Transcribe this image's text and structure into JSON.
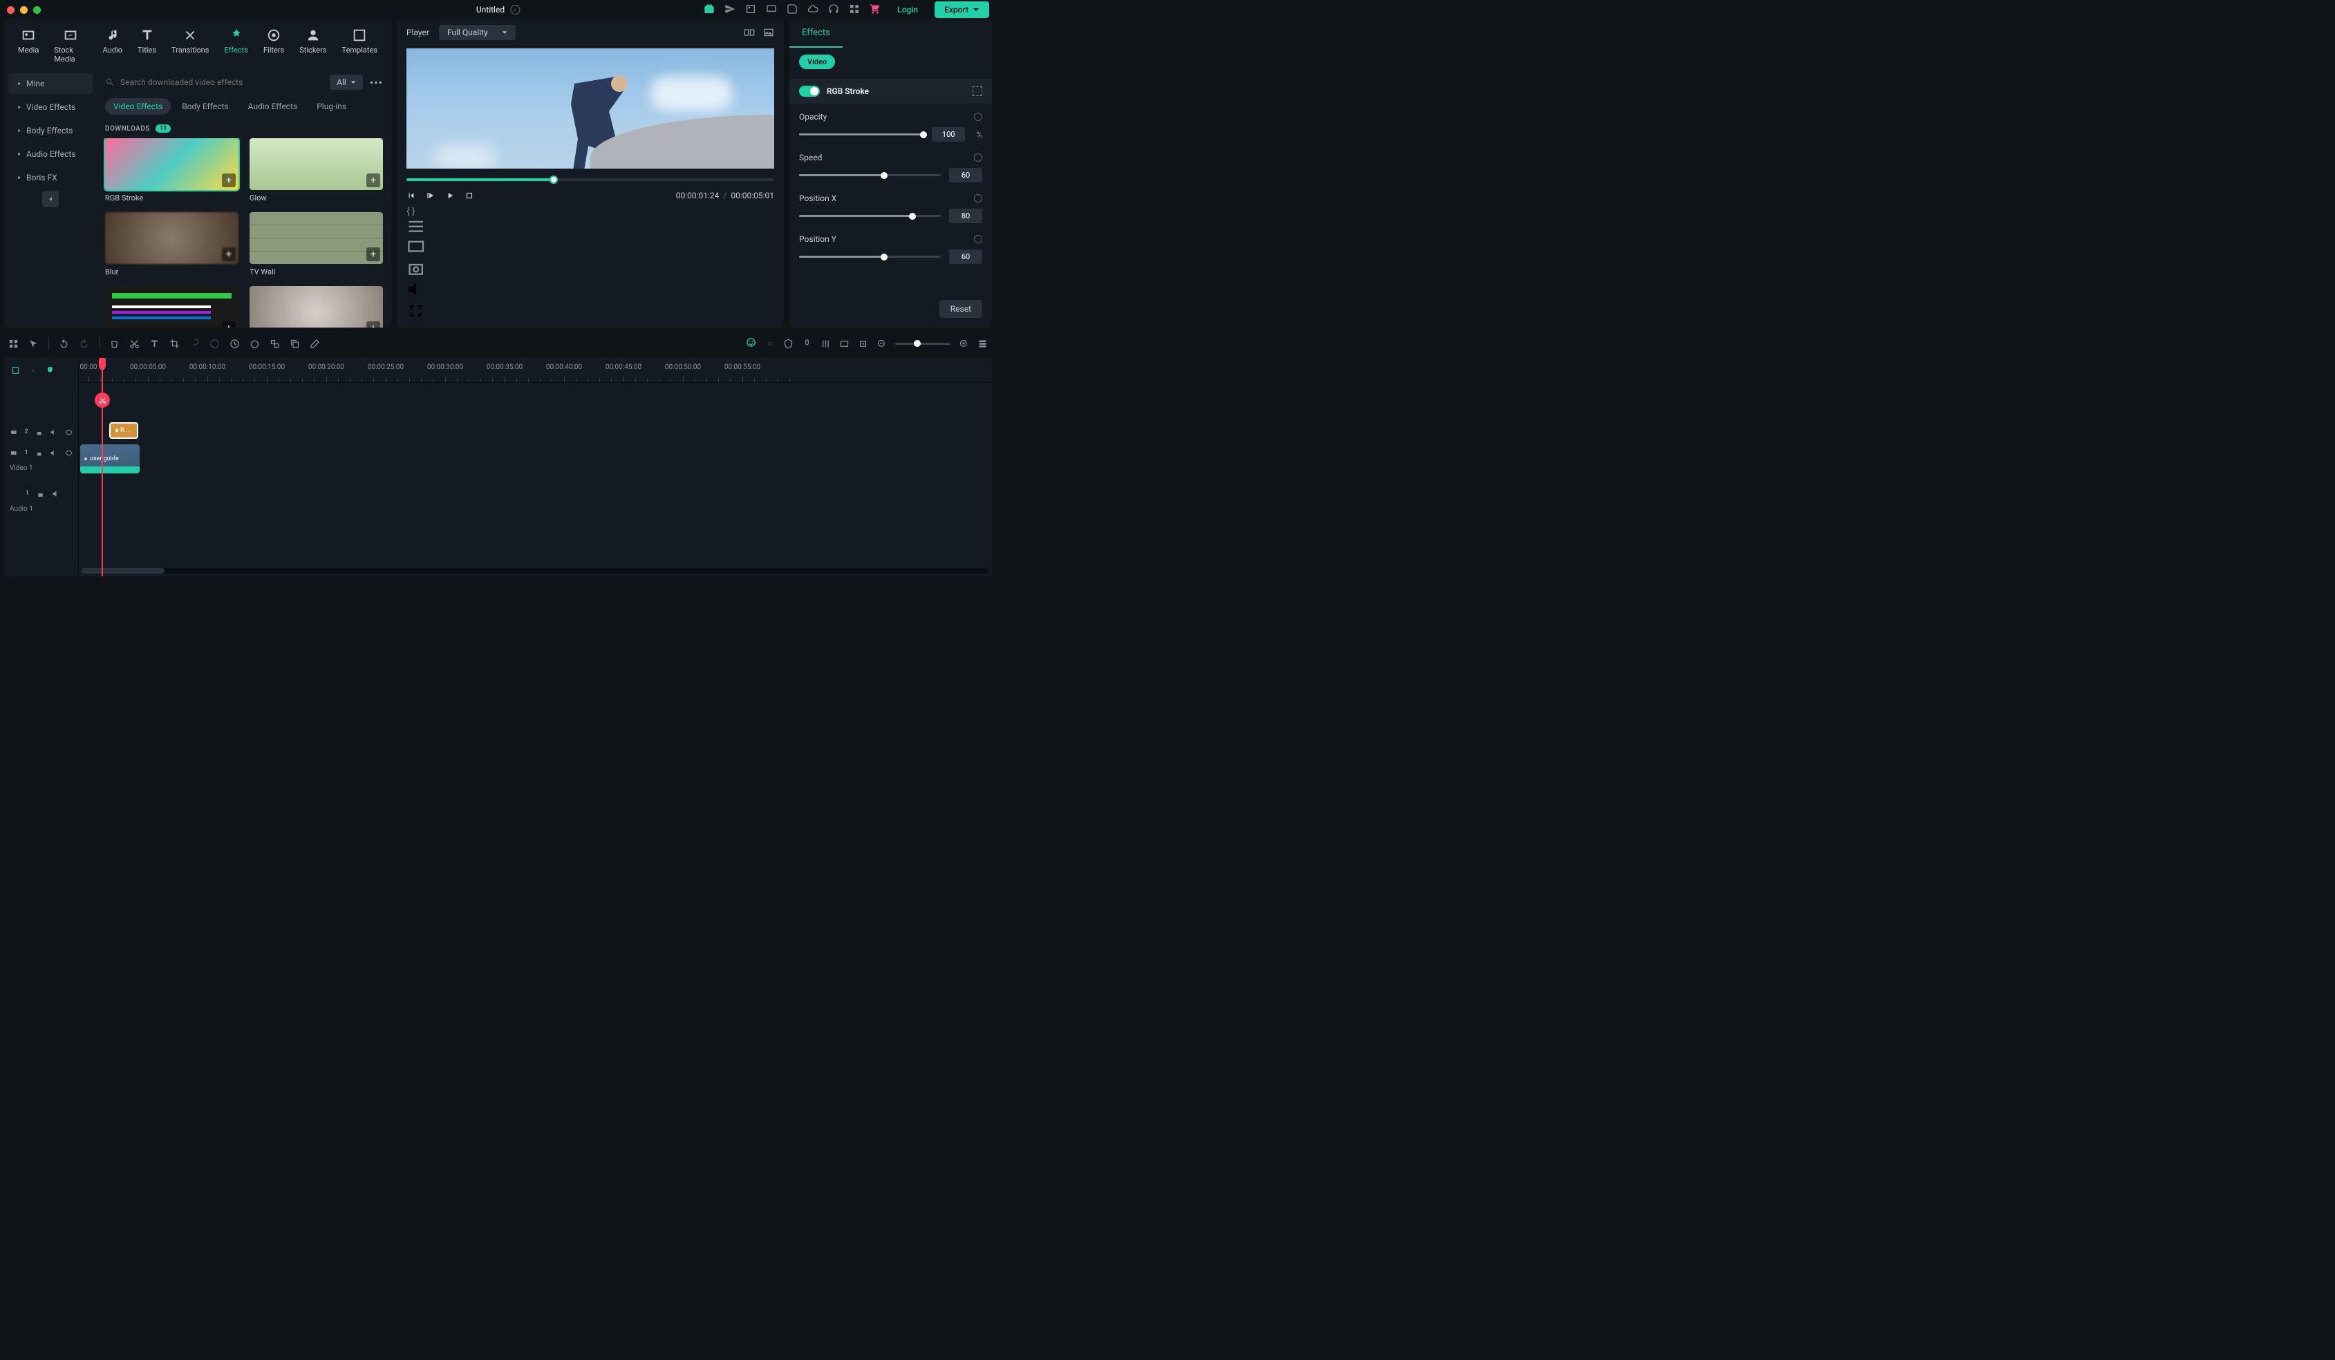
{
  "title": "Untitled",
  "header": {
    "login": "Login",
    "export": "Export"
  },
  "tabs": [
    "Media",
    "Stock Media",
    "Audio",
    "Titles",
    "Transitions",
    "Effects",
    "Filters",
    "Stickers",
    "Templates"
  ],
  "active_tab": 5,
  "sidebar": {
    "items": [
      "Mine",
      "Video Effects",
      "Body Effects",
      "Audio Effects",
      "Boris FX"
    ]
  },
  "search": {
    "placeholder": "Search downloaded video effects",
    "all": "All"
  },
  "sub_tabs": [
    "Video Effects",
    "Body Effects",
    "Audio Effects",
    "Plug-ins"
  ],
  "downloads": {
    "label": "DOWNLOADS",
    "count": "11"
  },
  "effects_grid": [
    {
      "name": "RGB Stroke",
      "selected": true,
      "cls": "th-rgb"
    },
    {
      "name": "Glow",
      "cls": "th-glow"
    },
    {
      "name": "Blur",
      "cls": "th-blur"
    },
    {
      "name": "TV Wall",
      "cls": "th-tv"
    },
    {
      "name": "",
      "cls": "th-glitch"
    },
    {
      "name": "",
      "cls": "th-sketch"
    }
  ],
  "player": {
    "label": "Player",
    "quality": "Full Quality",
    "current": "00:00:01:24",
    "total": "00:00:05:01"
  },
  "props": {
    "tab": "Effects",
    "pill": "Video",
    "effect": "RGB Stroke",
    "controls": [
      {
        "label": "Opacity",
        "value": "100",
        "pct": 100,
        "unit": "%"
      },
      {
        "label": "Speed",
        "value": "60",
        "pct": 60
      },
      {
        "label": "Position X",
        "value": "80",
        "pct": 80
      },
      {
        "label": "Position Y",
        "value": "60",
        "pct": 60
      }
    ],
    "reset": "Reset"
  },
  "ruler_marks": [
    "00:00",
    "00:00:05:00",
    "00:00:10:00",
    "00:00:15:00",
    "00:00:20:00",
    "00:00:25:00",
    "00:00:30:00",
    "00:00:35:00",
    "00:00:40:00",
    "00:00:45:00",
    "00:00:50:00",
    "00:00:55:00"
  ],
  "tracks": {
    "effect_clip": "R...",
    "video_clip": "user guide",
    "video_label": "Video 1",
    "audio_label": "Audio 1"
  }
}
